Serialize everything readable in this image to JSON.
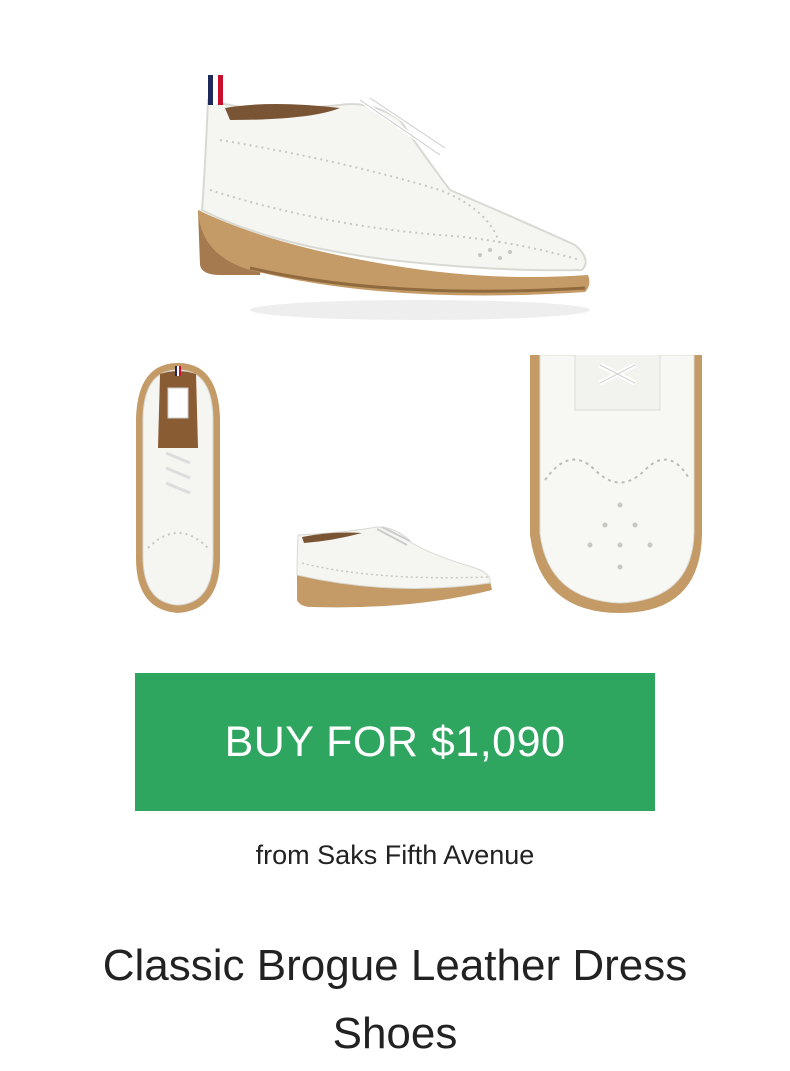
{
  "buy_button": {
    "label": "BUY FOR $1,090",
    "color": "#2ea660"
  },
  "retailer": {
    "text": "from Saks Fifth Avenue"
  },
  "product": {
    "title": "Classic Brogue Leather Dress Shoes"
  },
  "images": {
    "main": "product-main-image",
    "thumbnails": [
      "thumbnail-top-view",
      "thumbnail-side-view",
      "thumbnail-closeup"
    ]
  },
  "colors": {
    "leather": "#f4f4f0",
    "sole": "#c49a66",
    "stripe_red": "#c8102e",
    "stripe_navy": "#1f2a5c"
  }
}
